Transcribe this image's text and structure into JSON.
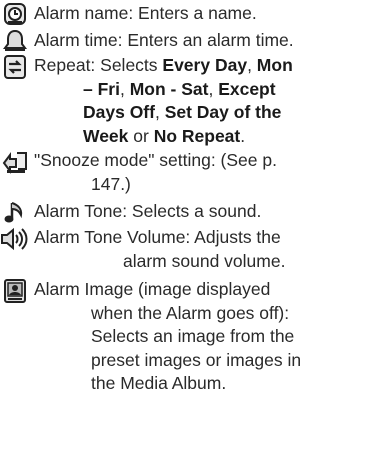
{
  "entries": [
    {
      "icon": "alarm-clock-icon",
      "lines": [
        "Alarm name: Enters a name."
      ]
    },
    {
      "icon": "bell-icon",
      "lines": [
        "Alarm time: Enters an alarm time."
      ]
    },
    {
      "icon": "repeat-icon",
      "line1": "Repeat: Selects ",
      "opt1": "Every Day",
      "sep1": ", ",
      "opt2": "Mon",
      "opt2b": "– Fri",
      "sep2": ", ",
      "opt3": "Mon - Sat",
      "sep3": ", ",
      "opt4": "Except",
      "opt4b": "Days Off",
      "sep4": ", ",
      "opt5": "Set Day of the",
      "opt5b": "Week",
      "sep5": " or ",
      "opt6": "No Repeat",
      "end": "."
    },
    {
      "icon": "snooze-icon",
      "lines": [
        "\"Snooze mode\" setting: (See p.",
        "147.)"
      ]
    },
    {
      "icon": "music-note-icon",
      "lines": [
        "Alarm Tone: Selects a sound."
      ]
    },
    {
      "icon": "speaker-volume-icon",
      "lines": [
        "Alarm Tone Volume: Adjusts the",
        "alarm sound volume."
      ]
    },
    {
      "icon": "image-icon",
      "lines": [
        "Alarm Image (image displayed",
        "when the Alarm goes off):",
        "Selects an image from the",
        "preset images or images in",
        "the Media Album."
      ]
    }
  ]
}
